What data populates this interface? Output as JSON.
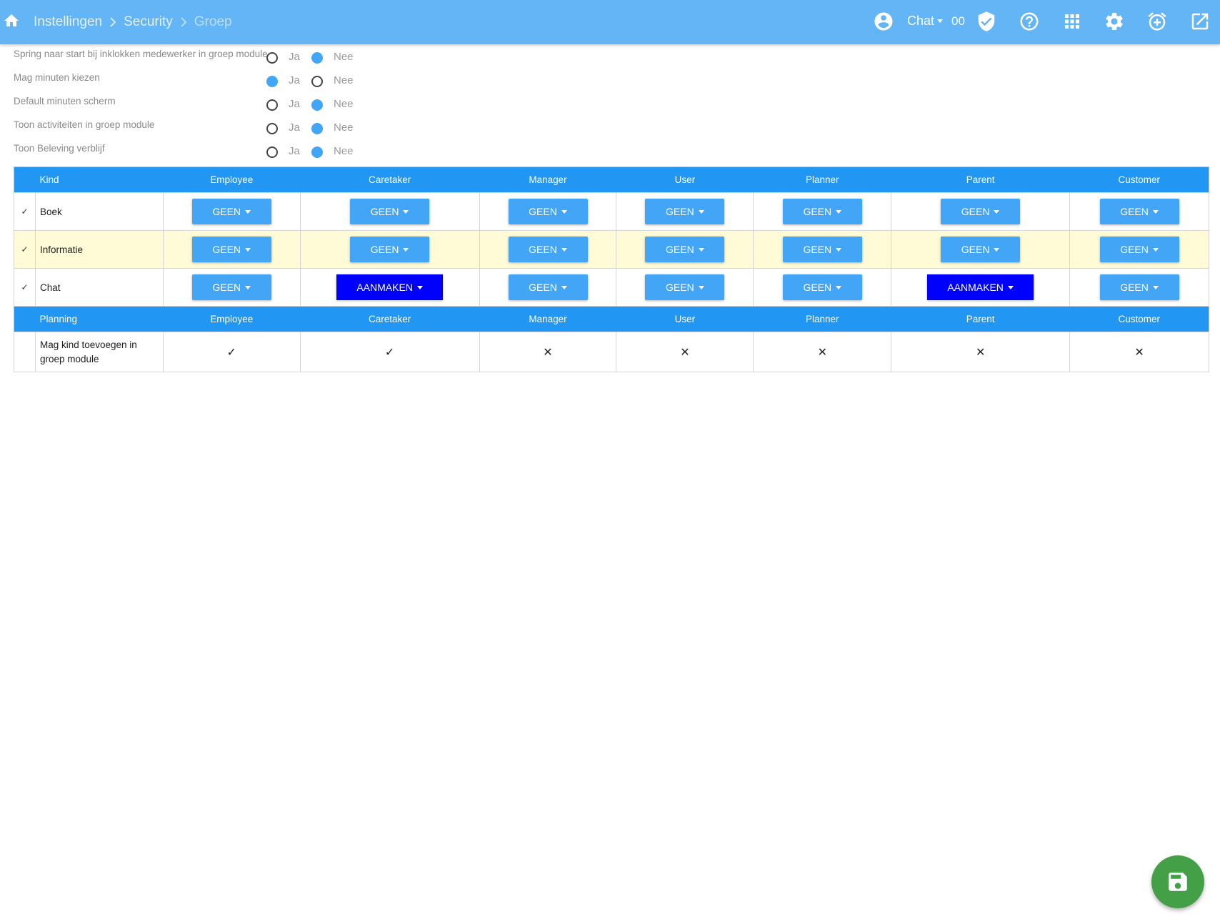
{
  "breadcrumb": {
    "items": [
      "Instellingen",
      "Security",
      "Groep"
    ]
  },
  "toolbar": {
    "chat_label": "Chat",
    "chat_count": "00",
    "icons": [
      "account-circle-icon",
      "shield-check-icon",
      "help-icon",
      "apps-grid-icon",
      "gear-icon",
      "alarm-add-icon",
      "open-external-icon"
    ]
  },
  "settings": [
    {
      "label": "Spring naar start bij inklokken medewerker in groep module",
      "yes": "Ja",
      "no": "Nee",
      "value": "Nee"
    },
    {
      "label": "Mag minuten kiezen",
      "yes": "Ja",
      "no": "Nee",
      "value": "Ja"
    },
    {
      "label": "Default minuten scherm",
      "yes": "Ja",
      "no": "Nee",
      "value": "Nee"
    },
    {
      "label": "Toon activiteiten in groep module",
      "yes": "Ja",
      "no": "Nee",
      "value": "Nee"
    },
    {
      "label": "Toon Beleving verblijf",
      "yes": "Ja",
      "no": "Nee",
      "value": "Nee"
    }
  ],
  "table": {
    "kind_header": "Kind",
    "roles": [
      "Employee",
      "Caretaker",
      "Manager",
      "User",
      "Planner",
      "Parent",
      "Customer"
    ],
    "rows": [
      {
        "name": "Boek",
        "checked": "✓",
        "values": [
          "GEEN",
          "GEEN",
          "GEEN",
          "GEEN",
          "GEEN",
          "GEEN",
          "GEEN"
        ]
      },
      {
        "name": "Informatie",
        "checked": "✓",
        "values": [
          "GEEN",
          "GEEN",
          "GEEN",
          "GEEN",
          "GEEN",
          "GEEN",
          "GEEN"
        ]
      },
      {
        "name": "Chat",
        "checked": "✓",
        "values": [
          "GEEN",
          "AANMAKEN",
          "GEEN",
          "GEEN",
          "GEEN",
          "AANMAKEN",
          "GEEN"
        ]
      }
    ],
    "planning_header": "Planning",
    "planning_rows": [
      {
        "name": "Mag kind toevoegen in groep module",
        "values": [
          "✓",
          "✓",
          "✕",
          "✕",
          "✕",
          "✕",
          "✕"
        ]
      }
    ]
  },
  "colors": {
    "topbar": "#64b5f6",
    "header": "#2196f3",
    "button_geen": "#42a5f5",
    "button_aanmaken": "#0000ff",
    "highlight_row": "#fffbd6",
    "save_fab": "#43a047"
  },
  "fab": {
    "icon": "save-icon"
  }
}
